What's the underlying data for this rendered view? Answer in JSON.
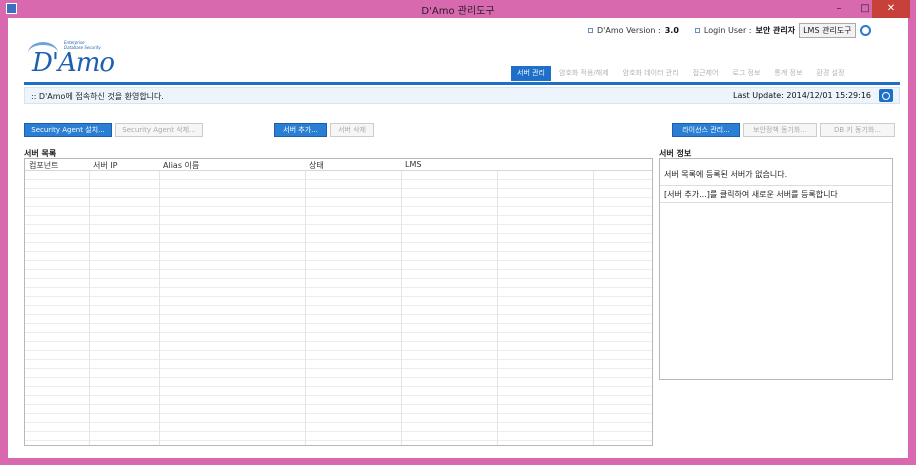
{
  "window": {
    "title": "D'Amo 관리도구",
    "minimize": "–",
    "maximize": "□",
    "close": "✕"
  },
  "logo": {
    "text": "D'Amo",
    "sub1": "Enterprise",
    "sub2": "Database Security"
  },
  "header": {
    "version_label": "D'Amo Version :",
    "version_value": "3.0",
    "user_label": "Login User :",
    "user_value": "보안 관리자",
    "lms_tool_button": "LMS 관리도구"
  },
  "tabs": [
    {
      "label": "서버 관리",
      "active": true
    },
    {
      "label": "암호화 적용/해제",
      "active": false
    },
    {
      "label": "암호화 데이터 관리",
      "active": false
    },
    {
      "label": "접근제어",
      "active": false
    },
    {
      "label": "로그 정보",
      "active": false
    },
    {
      "label": "통계 정보",
      "active": false
    },
    {
      "label": "환경 설정",
      "active": false
    }
  ],
  "message_bar": {
    "welcome": ":: D'Amo에 접속하신 것을 환영합니다.",
    "last_update": "Last Update: 2014/12/01 15:29:16"
  },
  "toolbar": {
    "install_agent": "Security Agent 설치...",
    "delete_agent": "Security Agent 삭제...",
    "add_server": "서버 추가...",
    "delete_server": "서버 삭제",
    "license_manage": "라이선스 관리...",
    "security_policy_sync": "보안정책 동기화...",
    "db_key_sync": "DB 키 동기화..."
  },
  "server_list": {
    "title": "서버 목록",
    "columns": [
      "컴포넌트",
      "서버 IP",
      "Alias 이름",
      "상태",
      "LMS"
    ],
    "rows": []
  },
  "server_info": {
    "title": "서버 정보",
    "line1": "서버 목록에 등록된 서버가 없습니다.",
    "line2": "[서버 추가...]를 클릭하여 새로운 서버를 등록합니다"
  },
  "colors": {
    "accent": "#1e6fc8",
    "title_bar": "#d869ae",
    "close_button": "#c7403a"
  }
}
